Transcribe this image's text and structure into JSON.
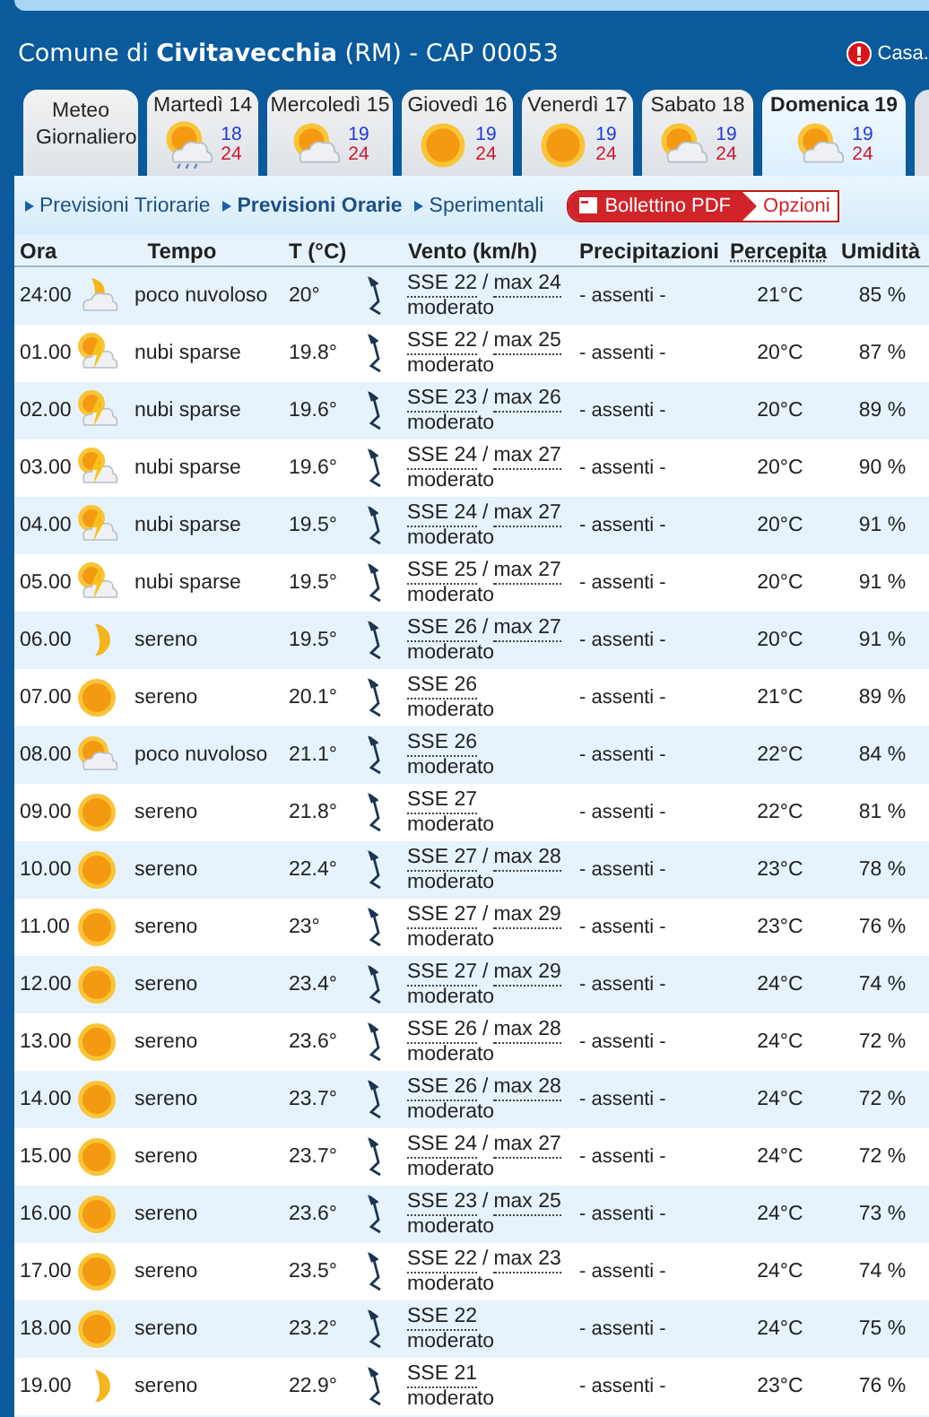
{
  "header": {
    "prefix": "Comune di",
    "city": "Civitavecchia",
    "suffix": "(RM) - CAP 00053",
    "link": "Casa."
  },
  "tabs": [
    {
      "label": "Meteo Giornaliero",
      "kind": "text",
      "selected": false
    },
    {
      "label": "Martedì 14",
      "kind": "rain-cloud",
      "min": "18",
      "max": "24",
      "selected": false
    },
    {
      "label": "Mercoledì 15",
      "kind": "sun-cloud",
      "min": "19",
      "max": "24",
      "selected": false
    },
    {
      "label": "Giovedì 16",
      "kind": "sun",
      "min": "19",
      "max": "24",
      "selected": false
    },
    {
      "label": "Venerdì 17",
      "kind": "sun",
      "min": "19",
      "max": "24",
      "selected": false
    },
    {
      "label": "Sabato 18",
      "kind": "sun-cloud",
      "min": "19",
      "max": "24",
      "selected": false
    },
    {
      "label": "Domenica 19",
      "kind": "sun-cloud",
      "min": "19",
      "max": "24",
      "selected": true
    }
  ],
  "nav": [
    {
      "label": "Previsioni Triorarie",
      "selected": false
    },
    {
      "label": "Previsioni Orarie",
      "selected": true
    },
    {
      "label": "Sperimentali",
      "selected": false
    }
  ],
  "buttons": {
    "pdf": "Bollettino PDF",
    "options": "Opzioni"
  },
  "columns": [
    "Ora",
    "Tempo",
    "T (°C)",
    "Vento (km/h)",
    "Precipitazioni",
    "Percepita",
    "Umidità"
  ],
  "rows": [
    {
      "time": "24:00",
      "kind": "moon-cloud",
      "sky": "poco nuvoloso",
      "temp": "20°",
      "wind": "SSE 22",
      "sep": "/",
      "gust": "max 24",
      "strength": "moderato",
      "rain": "- assenti -",
      "feel": "21°C",
      "humidity": "85 %"
    },
    {
      "time": "01.00",
      "kind": "storm-cloud",
      "sky": "nubi sparse",
      "temp": "19.8°",
      "wind": "SSE 22",
      "sep": "/",
      "gust": "max 25",
      "strength": "moderato",
      "rain": "- assenti -",
      "feel": "20°C",
      "humidity": "87 %"
    },
    {
      "time": "02.00",
      "kind": "storm-cloud",
      "sky": "nubi sparse",
      "temp": "19.6°",
      "wind": "SSE 23",
      "sep": "/",
      "gust": "max 26",
      "strength": "moderato",
      "rain": "- assenti -",
      "feel": "20°C",
      "humidity": "89 %"
    },
    {
      "time": "03.00",
      "kind": "storm-cloud",
      "sky": "nubi sparse",
      "temp": "19.6°",
      "wind": "SSE 24",
      "sep": "/",
      "gust": "max 27",
      "strength": "moderato",
      "rain": "- assenti -",
      "feel": "20°C",
      "humidity": "90 %"
    },
    {
      "time": "04.00",
      "kind": "storm-cloud",
      "sky": "nubi sparse",
      "temp": "19.5°",
      "wind": "SSE 24",
      "sep": "/",
      "gust": "max 27",
      "strength": "moderato",
      "rain": "- assenti -",
      "feel": "20°C",
      "humidity": "91 %"
    },
    {
      "time": "05.00",
      "kind": "storm-cloud",
      "sky": "nubi sparse",
      "temp": "19.5°",
      "wind": "SSE 25",
      "sep": "/",
      "gust": "max 27",
      "strength": "moderato",
      "rain": "- assenti -",
      "feel": "20°C",
      "humidity": "91 %"
    },
    {
      "time": "06.00",
      "kind": "moon",
      "sky": "sereno",
      "temp": "19.5°",
      "wind": "SSE 26",
      "sep": "/",
      "gust": "max 27",
      "strength": "moderato",
      "rain": "- assenti -",
      "feel": "20°C",
      "humidity": "91 %"
    },
    {
      "time": "07.00",
      "kind": "sun",
      "sky": "sereno",
      "temp": "20.1°",
      "wind": "SSE 26",
      "strength": "moderato",
      "rain": "- assenti -",
      "feel": "21°C",
      "humidity": "89 %"
    },
    {
      "time": "08.00",
      "kind": "sun-cloud",
      "sky": "poco nuvoloso",
      "temp": "21.1°",
      "wind": "SSE 26",
      "strength": "moderato",
      "rain": "- assenti -",
      "feel": "22°C",
      "humidity": "84 %"
    },
    {
      "time": "09.00",
      "kind": "sun",
      "sky": "sereno",
      "temp": "21.8°",
      "wind": "SSE 27",
      "strength": "moderato",
      "rain": "- assenti -",
      "feel": "22°C",
      "humidity": "81 %"
    },
    {
      "time": "10.00",
      "kind": "sun",
      "sky": "sereno",
      "temp": "22.4°",
      "wind": "SSE 27",
      "sep": "/",
      "gust": "max 28",
      "strength": "moderato",
      "rain": "- assenti -",
      "feel": "23°C",
      "humidity": "78 %"
    },
    {
      "time": "11.00",
      "kind": "sun",
      "sky": "sereno",
      "temp": "23°",
      "wind": "SSE 27",
      "sep": "/",
      "gust": "max 29",
      "strength": "moderato",
      "rain": "- assenti -",
      "feel": "23°C",
      "humidity": "76 %"
    },
    {
      "time": "12.00",
      "kind": "sun",
      "sky": "sereno",
      "temp": "23.4°",
      "wind": "SSE 27",
      "sep": "/",
      "gust": "max 29",
      "strength": "moderato",
      "rain": "- assenti -",
      "feel": "24°C",
      "humidity": "74 %"
    },
    {
      "time": "13.00",
      "kind": "sun",
      "sky": "sereno",
      "temp": "23.6°",
      "wind": "SSE 26",
      "sep": "/",
      "gust": "max 28",
      "strength": "moderato",
      "rain": "- assenti -",
      "feel": "24°C",
      "humidity": "72 %"
    },
    {
      "time": "14.00",
      "kind": "sun",
      "sky": "sereno",
      "temp": "23.7°",
      "wind": "SSE 26",
      "sep": "/",
      "gust": "max 28",
      "strength": "moderato",
      "rain": "- assenti -",
      "feel": "24°C",
      "humidity": "72 %"
    },
    {
      "time": "15.00",
      "kind": "sun",
      "sky": "sereno",
      "temp": "23.7°",
      "wind": "SSE 24",
      "sep": "/",
      "gust": "max 27",
      "strength": "moderato",
      "rain": "- assenti -",
      "feel": "24°C",
      "humidity": "72 %"
    },
    {
      "time": "16.00",
      "kind": "sun",
      "sky": "sereno",
      "temp": "23.6°",
      "wind": "SSE 23",
      "sep": "/",
      "gust": "max 25",
      "strength": "moderato",
      "rain": "- assenti -",
      "feel": "24°C",
      "humidity": "73 %"
    },
    {
      "time": "17.00",
      "kind": "sun",
      "sky": "sereno",
      "temp": "23.5°",
      "wind": "SSE 22",
      "sep": "/",
      "gust": "max 23",
      "strength": "moderato",
      "rain": "- assenti -",
      "feel": "24°C",
      "humidity": "74 %"
    },
    {
      "time": "18.00",
      "kind": "sun",
      "sky": "sereno",
      "temp": "23.2°",
      "wind": "SSE 22",
      "strength": "moderato",
      "rain": "- assenti -",
      "feel": "24°C",
      "humidity": "75 %"
    },
    {
      "time": "19.00",
      "kind": "moon",
      "sky": "sereno",
      "temp": "22.9°",
      "wind": "SSE 21",
      "strength": "moderato",
      "rain": "- assenti -",
      "feel": "23°C",
      "humidity": "76 %"
    }
  ]
}
